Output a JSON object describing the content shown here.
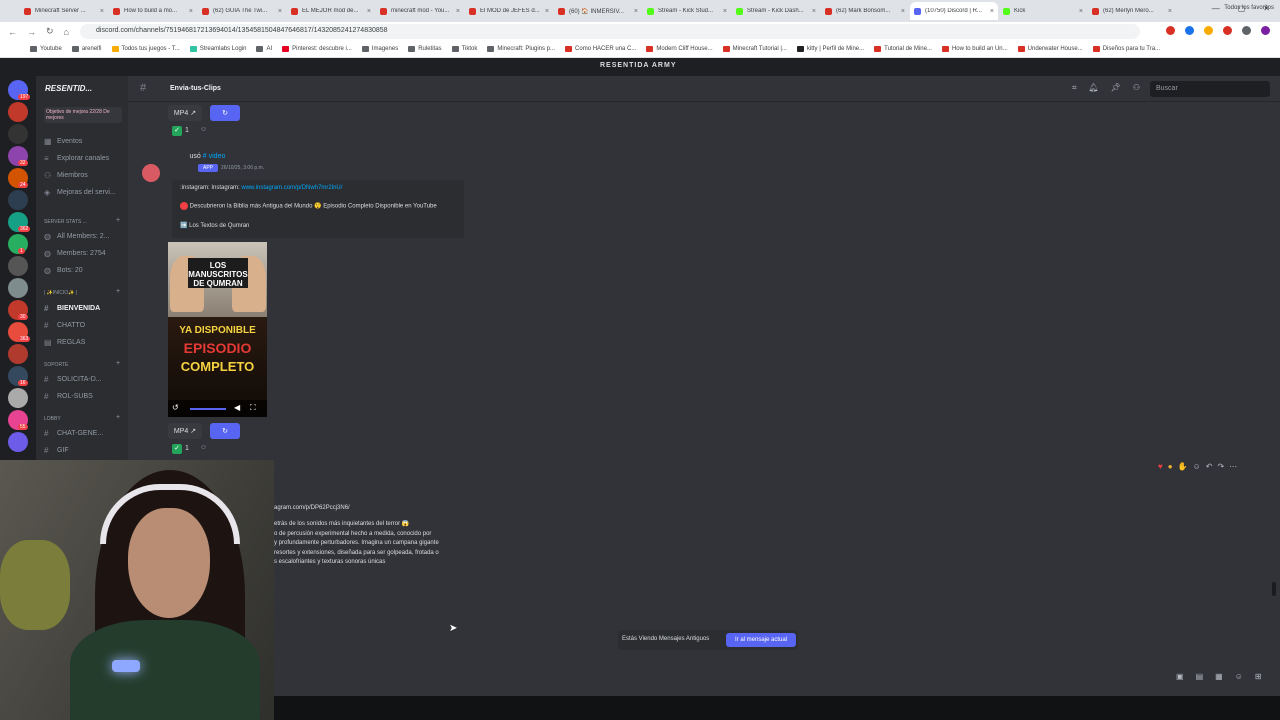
{
  "browser": {
    "tabs": [
      {
        "label": "Minecraft Server ...",
        "color": "#d93025",
        "active": false
      },
      {
        "label": "How to build a mo...",
        "color": "#d93025",
        "active": false
      },
      {
        "label": "(62) GUIA The Twi...",
        "color": "#d93025",
        "active": false
      },
      {
        "label": "EL MEJOR mod de...",
        "color": "#d93025",
        "active": false
      },
      {
        "label": "minecraft mod - You...",
        "color": "#d93025",
        "active": false
      },
      {
        "label": "El MOD de JEFES d...",
        "color": "#d93025",
        "active": false
      },
      {
        "label": "(60) 🏠 INMERSIV...",
        "color": "#d93025",
        "active": false
      },
      {
        "label": "Stream - Kick Stud...",
        "color": "#53fc18",
        "active": false
      },
      {
        "label": "Stream - Kick Dash...",
        "color": "#53fc18",
        "active": false
      },
      {
        "label": "(62) Mark Bonsom...",
        "color": "#d93025",
        "active": false
      },
      {
        "label": "(10750) Discord | R...",
        "color": "#5865f2",
        "active": true
      },
      {
        "label": "Kick",
        "color": "#53fc18",
        "active": false
      },
      {
        "label": "(62) Merlyn Mero...",
        "color": "#d93025",
        "active": false
      }
    ],
    "url": "discord.com/channels/751946817213694014/1354581504847646817/1432085241274830858",
    "bookmarks": [
      {
        "label": "Youtube",
        "color": "#5f6368"
      },
      {
        "label": "arenelfi",
        "color": "#5f6368"
      },
      {
        "label": "Todos tus juegos - T...",
        "color": "#f9ab00"
      },
      {
        "label": "Streamlabs Login",
        "color": "#31c3a2"
      },
      {
        "label": "AI",
        "color": "#5f6368"
      },
      {
        "label": "Pinterest: descubre i...",
        "color": "#e60023"
      },
      {
        "label": "Imagenes",
        "color": "#5f6368"
      },
      {
        "label": "Ruletitas",
        "color": "#5f6368"
      },
      {
        "label": "Tiktok",
        "color": "#5f6368"
      },
      {
        "label": "Minecraft: Plugins p...",
        "color": "#5f6368"
      },
      {
        "label": "Como HACER una C...",
        "color": "#d93025"
      },
      {
        "label": "Modern Cliff House...",
        "color": "#d93025"
      },
      {
        "label": "Minecraft Tutorial |...",
        "color": "#d93025"
      },
      {
        "label": "kitty | Perfil de Mine...",
        "color": "#202124"
      },
      {
        "label": "Tutorial de Mine...",
        "color": "#d93025"
      },
      {
        "label": "How to build an Un...",
        "color": "#d93025"
      },
      {
        "label": "Underwater House...",
        "color": "#d93025"
      },
      {
        "label": "Diseños para tu Tra...",
        "color": "#d93025"
      }
    ],
    "bookmarks_right": "Todos los favoritos"
  },
  "discord": {
    "server_title": "RESENTIDA ARMY",
    "server_name": "RESENTID...",
    "boost_text": "Objetivo de mejora   22/28 De mejores",
    "channel_name": "Envia-tus-Clips",
    "search_placeholder": "Buscar",
    "guild_badges": [
      "197",
      "",
      "",
      "32",
      "24",
      "",
      "362",
      "1",
      "",
      "",
      "30",
      "363",
      "",
      "16",
      "",
      "55",
      ""
    ],
    "sidebar": {
      "events": "Eventos",
      "explore": "Explorar canales",
      "members": "Miembros",
      "boosts": "Mejoras del servi...",
      "cat_stats": "SERVER STATS ...",
      "all_members": "All Members: 2...",
      "members_count": "Members: 2754",
      "bots": "Bots: 20",
      "cat_inicio": "| ✨INICIO✨ |",
      "ch_bienvenida": "BIENVENIDA",
      "ch_chatto": "CHATTO",
      "ch_reglas": "REGLAS",
      "cat_soporte": "SOPORTE",
      "ch_solicita": "SOLICITA-D...",
      "ch_rolsubs": "ROL-SUBS",
      "cat_lobby": "LOBBY",
      "ch_chatgen": "CHAT-GENE...",
      "ch_gif": "GIF"
    },
    "messages": {
      "mp4_label": "MP4",
      "reaction_count": "1",
      "used_text": "usó",
      "video_cmd": "# video",
      "app_tag": "APP",
      "timestamp": "26/10/25, 3:06 p.m.",
      "insta_prefix": ":instagram: Instagram:",
      "insta_link": "www.instagram.com/p/DNwh7mr2lnU/",
      "embed_line2": "Descubrieron la Biblia más Antigua del Mundo 😲 Episodio Completo Disponible en YouTube",
      "embed_line3": "➡️ Los Textos de Qumran",
      "thumb_title": "LOS MANUSCRITOS DE QUMRAN",
      "thumb_ya": "YA DISPONIBLE",
      "thumb_ep": "EPISODIO",
      "thumb_co": "COMPLETO",
      "msg2_link": "agram.com/p/DP62Pccj3N6/",
      "msg2_lines": [
        "etrás de los sonidos más inquietantes del terror 😱",
        "o de percusión experimental hecho a medida, conocido por",
        "y profundamente perturbadores. Imagina un campana gigante",
        "resortes y extensiones, diseñada para ser golpeada, frotada o",
        "s escalofriantes y texturas sonoras únicas"
      ]
    },
    "jump_text": "Estás Viendo Mensajes Antiguos",
    "jump_button": "Ir al mensaje actual"
  }
}
